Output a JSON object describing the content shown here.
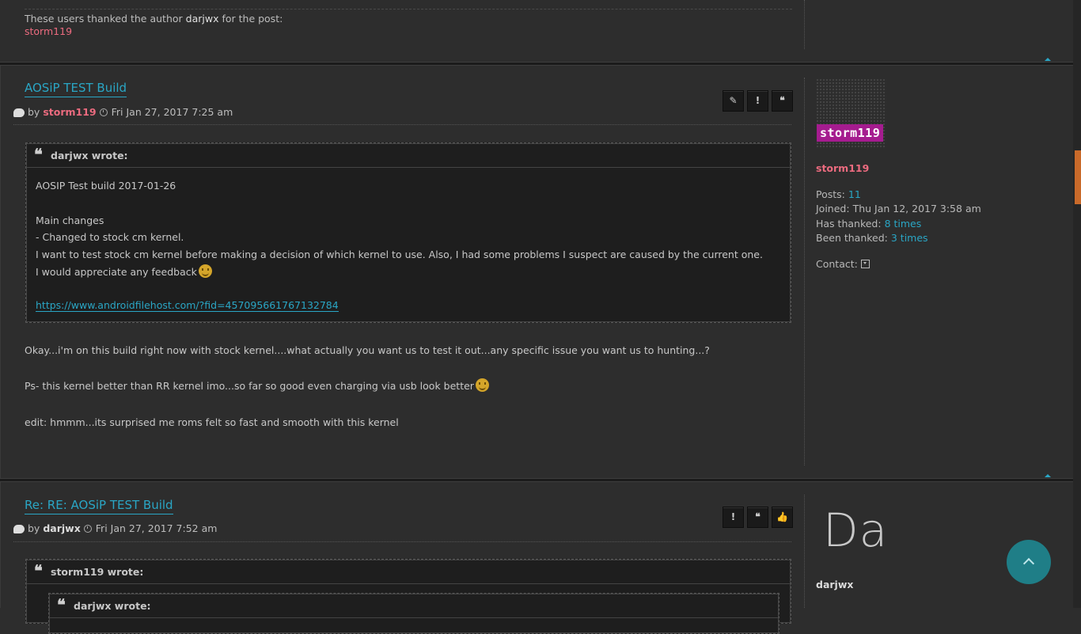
{
  "top_post": {
    "thanks_prefix": "These users thanked the author",
    "thanks_author": "darjwx",
    "thanks_suffix": "for the post:",
    "thanked_user": "storm119"
  },
  "post1": {
    "title": "AOSiP TEST Build",
    "by": "by",
    "author": "storm119",
    "date": "Fri Jan 27, 2017 7:25 am",
    "buttons": [
      "edit-icon",
      "report-icon",
      "quote-icon"
    ],
    "quote": {
      "who": "darjwx wrote:",
      "lines": [
        "AOSIP Test build 2017-01-26",
        "Main changes",
        "- Changed to stock cm kernel.",
        "I want to test stock cm kernel before making a decision of which kernel to use. Also, I had some problems I suspect are caused by the current one.",
        "I would appreciate any feedback"
      ],
      "link": "https://www.androidfilehost.com/?fid=457095661767132784"
    },
    "body": [
      "Okay...i'm on this build right now with stock kernel....what actually you want us to test it out...any specific issue you want us to hunting...?",
      "Ps- this kernel better than RR kernel imo...so far so good even charging via usb look better",
      "edit: hmmm...its surprised me roms felt so fast and smooth with this kernel"
    ],
    "profile": {
      "avatar_tag": "storm119",
      "name": "storm119",
      "posts_label": "Posts:",
      "posts_value": "11",
      "joined_label": "Joined:",
      "joined_value": "Thu Jan 12, 2017 3:58 am",
      "has_thanked_label": "Has thanked:",
      "has_thanked_value": "8 times",
      "been_thanked_label": "Been thanked:",
      "been_thanked_value": "3 times",
      "contact_label": "Contact:"
    }
  },
  "post2": {
    "title": "Re: RE: AOSiP TEST Build",
    "by": "by",
    "author": "darjwx",
    "date": "Fri Jan 27, 2017 7:52 am",
    "buttons": [
      "report-icon",
      "quote-icon",
      "thumbs-up-icon"
    ],
    "quote": {
      "who": "storm119 wrote:",
      "nested_who": "darjwx wrote:"
    },
    "profile": {
      "avatar_text": "Da",
      "name": "darjwx"
    }
  },
  "colors": {
    "accent": "#2aa6c5",
    "author": "#ec6b7f",
    "tag": "#a51c8f",
    "scroll_top": "#1f7e87"
  }
}
